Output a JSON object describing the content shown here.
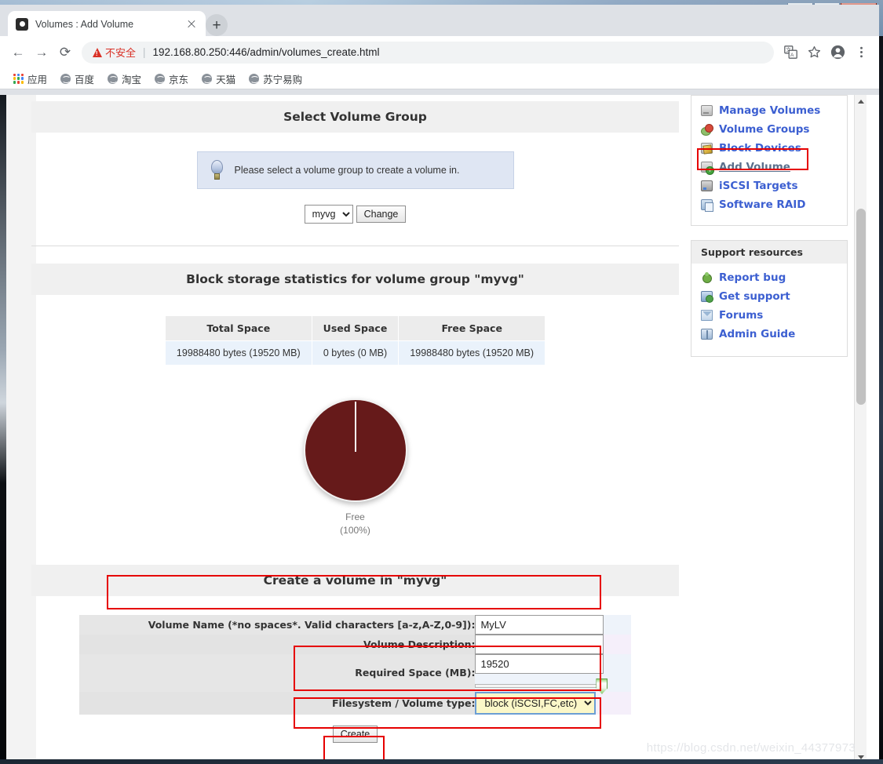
{
  "window": {
    "minimize_label": "minimize",
    "maximize_label": "maximize",
    "close_label": "×"
  },
  "browser": {
    "tab": {
      "title": "Volumes : Add Volume",
      "favicon_name": "volumes-favicon",
      "close_label": ""
    },
    "new_tab_label": "+",
    "nav": {
      "back_label": "←",
      "forward_label": "→",
      "reload_label": "⟳"
    },
    "omnibox": {
      "security_text": "不安全",
      "separator": "|",
      "url": "192.168.80.250:446/admin/volumes_create.html"
    },
    "toolbar_icons": [
      "translate-icon",
      "bookmark-star-icon",
      "profile-avatar-icon",
      "chrome-menu-icon"
    ],
    "bookmarks": [
      {
        "label": "应用",
        "icon": "apps-grid-icon"
      },
      {
        "label": "百度",
        "icon": "globe-icon"
      },
      {
        "label": "淘宝",
        "icon": "globe-icon"
      },
      {
        "label": "京东",
        "icon": "globe-icon"
      },
      {
        "label": "天猫",
        "icon": "globe-icon"
      },
      {
        "label": "苏宁易购",
        "icon": "globe-icon"
      }
    ]
  },
  "page": {
    "volume_group_section": {
      "title": "Select Volume Group",
      "hint": "Please select a volume group to create a volume in.",
      "hint_icon": "lightbulb-icon",
      "selected_group": "myvg",
      "group_options": [
        "myvg"
      ],
      "change_button": "Change"
    },
    "stats_section": {
      "title": "Block storage statistics for volume group \"myvg\"",
      "columns": [
        "Total Space",
        "Used Space",
        "Free Space"
      ],
      "row": [
        "19988480 bytes (19520 MB)",
        "0 bytes (0 MB)",
        "19988480 bytes (19520 MB)"
      ]
    },
    "chart_data": {
      "type": "pie",
      "title": "",
      "labels": [
        "Free"
      ],
      "values": [
        100
      ],
      "value_unit": "%",
      "colors": [
        "#661a1a"
      ],
      "annotations": [
        "Free",
        "(100%)"
      ],
      "legend": "below",
      "caption_line1": "Free",
      "caption_line2": "(100%)"
    },
    "create_section": {
      "title": "Create a volume in \"myvg\"",
      "fields": [
        {
          "label": "Volume Name (*no spaces*. Valid characters [a-z,A-Z,0-9]):",
          "value": "MyLV",
          "type": "text",
          "highlighted": true
        },
        {
          "label": "Volume Description:",
          "value": "",
          "type": "text",
          "highlighted": false
        },
        {
          "label": "Required Space (MB):",
          "value": "19520",
          "type": "text-slider",
          "slider_percent": 100,
          "highlighted": true
        },
        {
          "label": "Filesystem / Volume type:",
          "value": "block (iSCSI,FC,etc)",
          "options": [
            "block (iSCSI,FC,etc)"
          ],
          "type": "select",
          "highlighted": true
        }
      ],
      "submit_label": "Create"
    }
  },
  "sidebar": {
    "volumes_menu": [
      {
        "label": "Manage Volumes",
        "icon": "drive-icon",
        "active": false
      },
      {
        "label": "Volume Groups",
        "icon": "volume-group-icon",
        "active": false
      },
      {
        "label": "Block Devices",
        "icon": "block-device-icon",
        "active": false
      },
      {
        "label": "Add Volume",
        "icon": "add-volume-icon",
        "active": true
      },
      {
        "label": "iSCSI Targets",
        "icon": "iscsi-target-icon",
        "active": false
      },
      {
        "label": "Software RAID",
        "icon": "software-raid-icon",
        "active": false
      }
    ],
    "support": {
      "title": "Support resources",
      "items": [
        {
          "label": "Report bug",
          "icon": "bug-icon"
        },
        {
          "label": "Get support",
          "icon": "support-icon"
        },
        {
          "label": "Forums",
          "icon": "forums-icon"
        },
        {
          "label": "Admin Guide",
          "icon": "admin-guide-icon"
        }
      ]
    }
  },
  "watermark": "https://blog.csdn.net/weixin_44377973",
  "colors": {
    "link_blue": "#3c5fd1",
    "pie_red": "#661a1a",
    "annotation_red": "#e60000",
    "insecure_red": "#d93025"
  }
}
